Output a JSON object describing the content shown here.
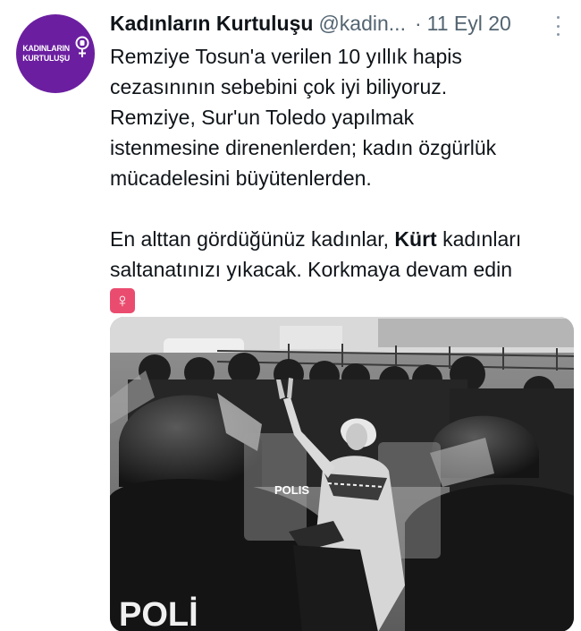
{
  "tweet": {
    "avatar": {
      "line1": "KADINLARIN",
      "line2": "KURTULUŞU",
      "symbol": "feminist-fist-venus-symbol",
      "background": "#6b1fa0"
    },
    "author": {
      "display_name": "Kadınların Kurtuluşu",
      "handle": "@kadin...",
      "separator": "·",
      "date": "11 Eyl 20"
    },
    "more_icon": "three-dots-vertical-icon",
    "text": {
      "line1": "Remziye Tosun'a verilen 10 yıllık hapis",
      "line2": "cezasınının sebebini çok iyi biliyoruz.",
      "line3": "Remziye, Sur'un Toledo yapılmak",
      "line4": "istenmesine direnenlerden; kadın özgürlük",
      "line5": "mücadelesini büyütenlerden.",
      "line6_before": "En alttan gördüğünüz kadınlar, ",
      "line6_bold": "Kürt",
      "line6_after": " kadınları",
      "line7": "saltanatınızı yıkacak. Korkmaya devam edin",
      "emoji": "♀"
    },
    "media": {
      "description_icon": "photo",
      "shield_text": "POLIS",
      "vest_text": "POLİ"
    },
    "colors": {
      "venus_bg": "#ea4c6f",
      "secondary_text": "#536471"
    }
  }
}
